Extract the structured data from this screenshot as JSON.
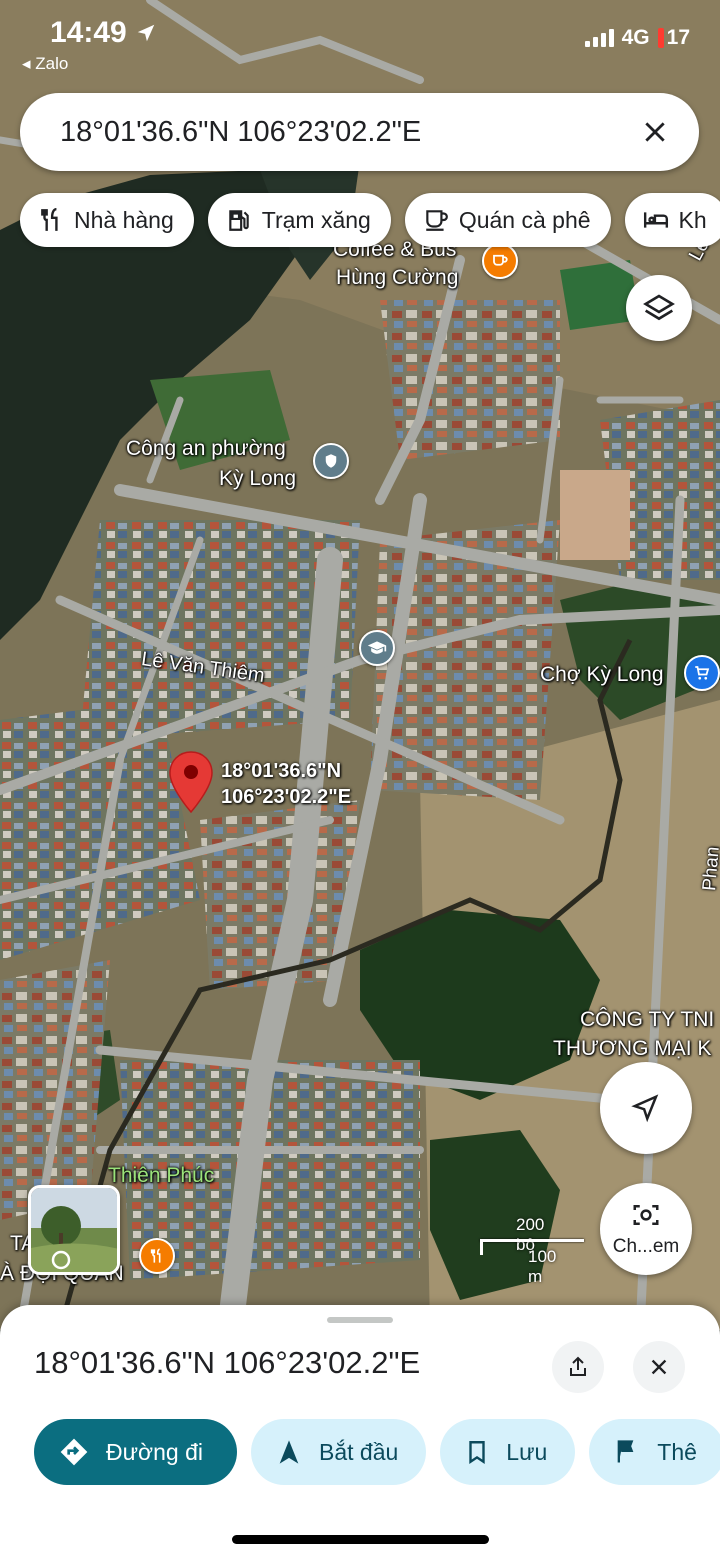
{
  "status_bar": {
    "time": "14:49",
    "back_app": "Zalo",
    "network": "4G",
    "battery": "17"
  },
  "search": {
    "query": "18°01'36.6\"N 106°23'02.2\"E"
  },
  "chips": [
    {
      "icon": "restaurant-icon",
      "label": "Nhà hàng"
    },
    {
      "icon": "gas-station-icon",
      "label": "Trạm xăng"
    },
    {
      "icon": "coffee-icon",
      "label": "Quán cà phê"
    },
    {
      "icon": "hotel-icon",
      "label": "Kh"
    }
  ],
  "map": {
    "labels": {
      "coffee_1": "Coffee & Bus",
      "coffee_2": "Hùng Cường",
      "police_1": "Công an phường",
      "police_2": "Kỳ Long",
      "street": "Lê Văn Thiêm",
      "market": "Chợ Kỳ Long",
      "company_1": "CÔNG TY TNI",
      "company_2": "THƯƠNG MẠI K",
      "thien_phuc": "Thiên Phúc",
      "left_1": "TA",
      "left_2": "À ĐỘI QUÂN",
      "road_top": "Lê V",
      "road_right": "Phan"
    },
    "pin": {
      "line1": "18°01'36.6\"N",
      "line2": "106°23'02.2\"E",
      "color": "#e53935"
    },
    "scale": {
      "imperial": "200 bộ",
      "metric": "100 m"
    },
    "camera_label": "Ch...em"
  },
  "sheet": {
    "title": "18°01'36.6\"N 106°23'02.2\"E",
    "actions": [
      {
        "icon": "directions-icon",
        "label": "Đường đi"
      },
      {
        "icon": "navigation-arrow-icon",
        "label": "Bắt đầu"
      },
      {
        "icon": "bookmark-icon",
        "label": "Lưu"
      },
      {
        "icon": "flag-icon",
        "label": "Thê"
      }
    ]
  },
  "colors": {
    "primary": "#0b6e80",
    "secondary_bg": "#d6f1fb",
    "pin": "#e53935",
    "market_badge": "#1a73e8",
    "coffee_badge": "#f57c00"
  }
}
